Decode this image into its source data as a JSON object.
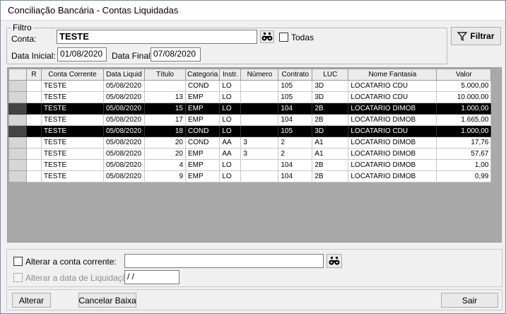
{
  "window": {
    "title": "Conciliação Bancária - Contas Liquidadas"
  },
  "filtro": {
    "legend": "Filtro",
    "conta_label": "Conta:",
    "conta_value": "TESTE",
    "todas_label": "Todas",
    "data_inicial_label": "Data Inicial:",
    "data_inicial_value": "01/08/2020",
    "data_final_label": "Data Final:",
    "data_final_value": "07/08/2020",
    "filtrar_label": "Filtrar"
  },
  "grid": {
    "columns": [
      "R",
      "Conta Corrente",
      "Data Liquid",
      "Título",
      "Categoria",
      "Instr.",
      "Número",
      "Contrato",
      "LUC",
      "Nome Fantasia",
      "Valor"
    ],
    "rows": [
      [
        "",
        "TESTE",
        "05/08/2020",
        "",
        "COND",
        "LO",
        "",
        "105",
        "3D",
        "LOCATARIO CDU",
        "5.000,00"
      ],
      [
        "",
        "TESTE",
        "05/08/2020",
        "13",
        "EMP",
        "LO",
        "",
        "105",
        "3D",
        "LOCATARIO CDU",
        "10.000,00"
      ],
      [
        "",
        "TESTE",
        "05/08/2020",
        "15",
        "EMP",
        "LO",
        "",
        "104",
        "2B",
        "LOCATARIO DIMOB",
        "1.000,00"
      ],
      [
        "",
        "TESTE",
        "05/08/2020",
        "17",
        "EMP",
        "LO",
        "",
        "104",
        "2B",
        "LOCATARIO DIMOB",
        "1.665,00"
      ],
      [
        "",
        "TESTE",
        "05/08/2020",
        "18",
        "COND",
        "LO",
        "",
        "105",
        "3D",
        "LOCATARIO CDU",
        "1.000,00"
      ],
      [
        "",
        "TESTE",
        "05/08/2020",
        "20",
        "COND",
        "AA",
        "3",
        "2",
        "A1",
        "LOCATARIO DIMOB",
        "17,76"
      ],
      [
        "",
        "TESTE",
        "05/08/2020",
        "20",
        "EMP",
        "AA",
        "3",
        "2",
        "A1",
        "LOCATARIO DIMOB",
        "57,67"
      ],
      [
        "",
        "TESTE",
        "05/08/2020",
        "4",
        "EMP",
        "LO",
        "",
        "104",
        "2B",
        "LOCATARIO DIMOB",
        "1,00"
      ],
      [
        "",
        "TESTE",
        "05/08/2020",
        "9",
        "EMP",
        "LO",
        "",
        "104",
        "2B",
        "LOCATARIO DIMOB",
        "0,99"
      ]
    ],
    "highlighted_rows": [
      2,
      4
    ]
  },
  "alterar": {
    "conta_label": "Alterar a conta corrente:",
    "conta_value": "",
    "data_label": "Alterar a data de Liquidação:",
    "data_value": " / /"
  },
  "footer": {
    "alterar_label": "Alterar",
    "cancelar_label": "Cancelar Baixa",
    "sair_label": "Sair"
  }
}
